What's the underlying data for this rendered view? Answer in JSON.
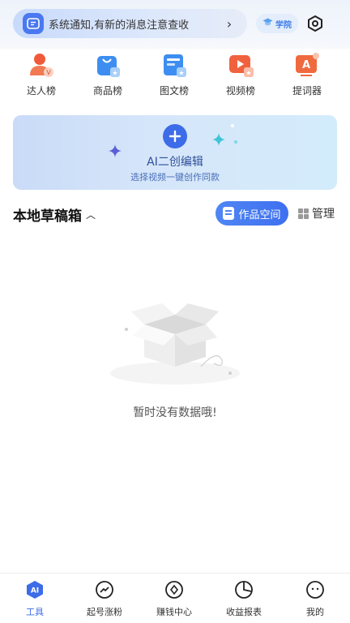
{
  "header": {
    "notice_text": "系统通知,有新的消息注意查收",
    "academy_label": "学院"
  },
  "tools": [
    {
      "label": "达人榜",
      "icon": "influencer-ranking-icon"
    },
    {
      "label": "商品榜",
      "icon": "product-ranking-icon"
    },
    {
      "label": "图文榜",
      "icon": "image-text-ranking-icon"
    },
    {
      "label": "视频榜",
      "icon": "video-ranking-icon"
    },
    {
      "label": "提词器",
      "icon": "teleprompter-icon"
    }
  ],
  "ai_banner": {
    "title": "AI二创编辑",
    "subtitle": "选择视频一键创作同款"
  },
  "drafts": {
    "title": "本地草稿箱",
    "workspace_label": "作品空间",
    "manage_label": "管理",
    "empty_text": "暂时没有数据哦!"
  },
  "tabbar": {
    "active_index": 0,
    "tabs": [
      {
        "label": "工具",
        "icon": "ai-tools-icon"
      },
      {
        "label": "起号涨粉",
        "icon": "growth-icon"
      },
      {
        "label": "赚钱中心",
        "icon": "earn-money-icon"
      },
      {
        "label": "收益报表",
        "icon": "revenue-report-icon"
      },
      {
        "label": "我的",
        "icon": "profile-icon"
      }
    ]
  },
  "colors": {
    "accent": "#3d6ce8",
    "banner_start": "#c9dbf7",
    "banner_end": "#d3ecfb"
  }
}
